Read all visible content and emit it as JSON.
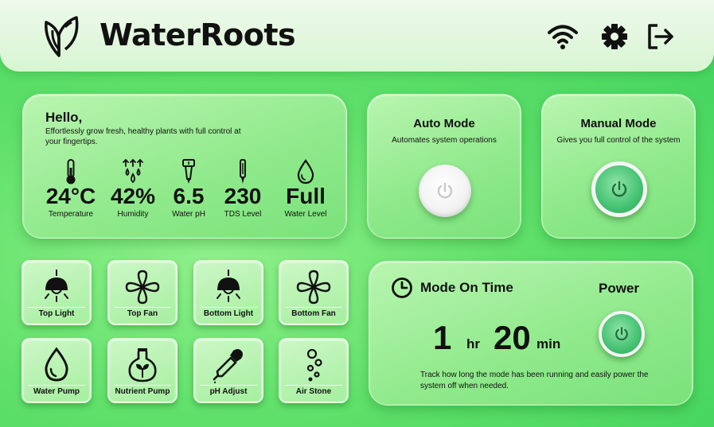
{
  "header": {
    "app_title": "WaterRoots",
    "icons": [
      "leaf-logo-icon",
      "wifi-icon",
      "gear-icon",
      "logout-icon"
    ]
  },
  "hello": {
    "title": "Hello,",
    "subtitle": "Effortlessly grow fresh, healthy plants with full control at your fingertips.",
    "metrics": [
      {
        "icon": "thermometer-icon",
        "value": "24°C",
        "label": "Temperature"
      },
      {
        "icon": "humidity-icon",
        "value": "42%",
        "label": "Humidity"
      },
      {
        "icon": "ph-probe-icon",
        "value": "6.5",
        "label": "Water pH"
      },
      {
        "icon": "tds-probe-icon",
        "value": "230",
        "label": "TDS Level"
      },
      {
        "icon": "water-drop-icon",
        "value": "Full",
        "label": "Water Level"
      }
    ]
  },
  "modes": {
    "auto": {
      "title": "Auto Mode",
      "subtitle": "Automates system operations",
      "state": "off"
    },
    "manual": {
      "title": "Manual Mode",
      "subtitle": "Gives you full control of the system",
      "state": "on"
    }
  },
  "controls": [
    {
      "label": "Top Light",
      "icon": "hanging-lamp-icon"
    },
    {
      "label": "Top Fan",
      "icon": "fan-icon"
    },
    {
      "label": "Bottom Light",
      "icon": "hanging-lamp-icon"
    },
    {
      "label": "Bottom Fan",
      "icon": "fan-icon"
    },
    {
      "label": "Water Pump",
      "icon": "water-drop-icon"
    },
    {
      "label": "Nutrient Pump",
      "icon": "nutrient-flask-icon"
    },
    {
      "label": "pH Adjust",
      "icon": "dropper-icon"
    },
    {
      "label": "Air Stone",
      "icon": "bubbles-icon"
    }
  ],
  "timer": {
    "title": "Mode On Time",
    "hours": "1",
    "hours_unit": "hr",
    "minutes": "20",
    "minutes_unit": "min",
    "description": "Track how long the mode has been running and easily power the system off when needed.",
    "power_title": "Power"
  },
  "colors": {
    "background": "#5fe06a",
    "card": "#a5ef9f",
    "power_on": "#45c272",
    "header": "#e6f8e2"
  }
}
